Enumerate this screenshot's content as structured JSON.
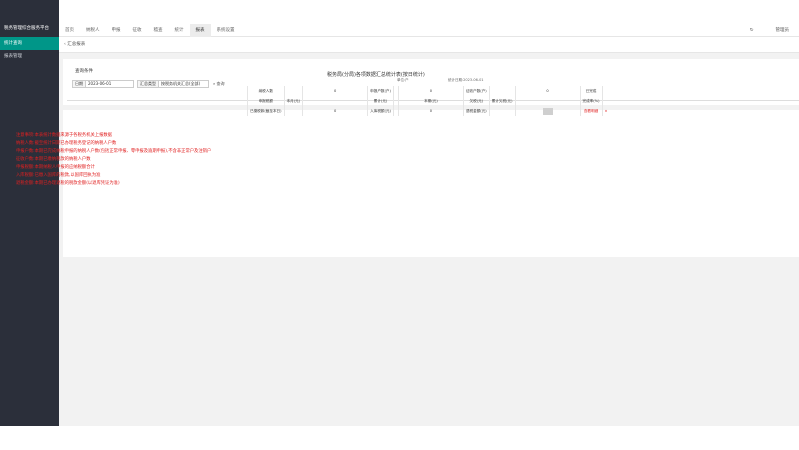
{
  "app": {
    "brand": "税务管理综合服务平台"
  },
  "sidebar": {
    "items": [
      {
        "label": "统计查询"
      },
      {
        "label": "报表管理"
      }
    ]
  },
  "topnav": {
    "items": [
      {
        "label": "首页"
      },
      {
        "label": "纳税人"
      },
      {
        "label": "申报"
      },
      {
        "label": "征收"
      },
      {
        "label": "稽查"
      },
      {
        "label": "统计"
      },
      {
        "label": "报表"
      },
      {
        "label": "系统设置"
      }
    ],
    "selected_index": 6
  },
  "topright": {
    "icon": "refresh-icon",
    "user": "管理员"
  },
  "tab": {
    "label": "汇总报表"
  },
  "filters": {
    "legend": "查询条件",
    "date_label": "日期",
    "date_value": "2023-06-01",
    "type_label": "汇总类型",
    "type_value": "按税务机关汇总(全部)",
    "query_label": "查询"
  },
  "report": {
    "title": "税务局(分局)各项数据汇总统计表(按日统计)",
    "subtitle": "单位:户",
    "subtitle_right": "统计日期:2023-06-01",
    "rows": [
      [
        {
          "text": "纳税人数"
        },
        {
          "text": ""
        },
        {
          "text": "0"
        },
        {
          "text": "申报户数(户)"
        },
        {
          "text": ""
        },
        {
          "text": "0"
        },
        {
          "text": "征收户数(户)"
        },
        {
          "text": ""
        },
        {
          "text": "0"
        },
        {
          "text": "已完成"
        },
        {
          "text": ""
        }
      ],
      [
        {
          "text": "申报税额"
        },
        {
          "text": "本月(元)"
        },
        {
          "text": ""
        },
        {
          "text": "累计(元)"
        },
        {
          "text": ""
        },
        {
          "text": "本期(元)"
        },
        {
          "text": "欠税(元)"
        },
        {
          "text": "累计欠税(元)"
        },
        {
          "text": ""
        },
        {
          "text": "完成率(%)"
        },
        {
          "text": ""
        }
      ],
      [
        {
          "text": "已缴税款(截至本日)"
        },
        {
          "text": ""
        },
        {
          "text": "0"
        },
        {
          "text": "入库税额(元)"
        },
        {
          "text": ""
        },
        {
          "text": "0"
        },
        {
          "text": "退税金额(元)"
        },
        {
          "text": ""
        },
        {
          "text": "",
          "gray": true
        },
        {
          "text": "查看明细",
          "red": true
        },
        {
          "text": "×",
          "red": true
        }
      ]
    ]
  },
  "notes": [
    "注意事项:本表统计数据来源于各税务机关上报数据",
    "纳税人数:截至统计日期已办理税务登记的纳税人户数",
    "申报户数:本期已完成纳税申报的纳税人户数(包括正常申报、零申报及逾期申报),不含非正常户及注销户",
    "征收户数:本期已缴纳税款的纳税人户数",
    "申报税额:本期纳税人申报的应纳税额合计",
    "入库税额:已缴入国库的税款,以国库回执为准",
    "退税金额:本期已办理退税的税款金额(以退库凭证为准)"
  ]
}
